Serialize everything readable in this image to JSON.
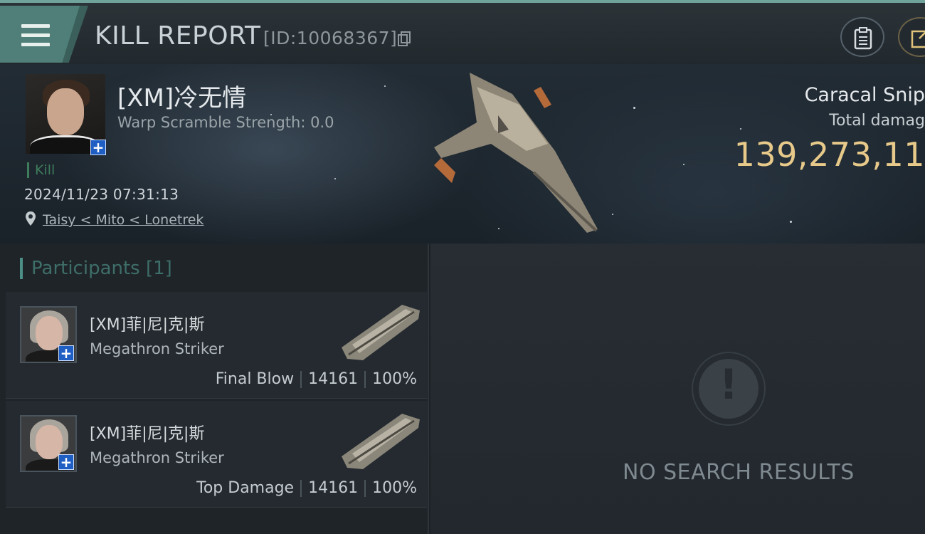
{
  "header": {
    "title": "KILL REPORT",
    "report_id": "[ID:10068367]",
    "menu_icon": "hamburger-menu-icon",
    "copy_icon": "copy-icon",
    "clipboard_icon": "clipboard-icon",
    "external_icon": "external-link-icon"
  },
  "victim": {
    "name": "[XM]冷无情",
    "warp_scramble": "Warp Scramble Strength: 0.0",
    "kill_tag": "Kill",
    "datetime": "2024/11/23 07:31:13",
    "location": "Taisy < Mito < Lonetrek",
    "ship_name": "Caracal Snip",
    "total_damage_label": "Total damag",
    "total_damage_value": "139,273,11"
  },
  "participants": {
    "header": "Participants [1]",
    "items": [
      {
        "name": "[XM]菲|尼|克|斯",
        "ship": "Megathron Striker",
        "role": "Final Blow",
        "damage": "14161",
        "percent": "100%"
      },
      {
        "name": "[XM]菲|尼|克|斯",
        "ship": "Megathron Striker",
        "role": "Top Damage",
        "damage": "14161",
        "percent": "100%"
      }
    ]
  },
  "empty_state": {
    "message": "NO SEARCH RESULTS"
  },
  "colors": {
    "accent": "#4f7f78",
    "damage_gold": "#e7c98a",
    "kill_green": "#3e7c5b",
    "badge_blue": "#1f5fc4"
  }
}
